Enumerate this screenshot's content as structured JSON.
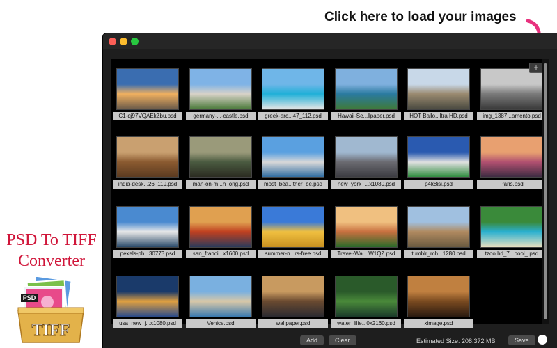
{
  "promo": {
    "title_line1": "PSD To TIFF",
    "title_line2": "Converter",
    "icon_psd_label": "PSD",
    "icon_tiff_label": "TIFF"
  },
  "hint": {
    "text": "Click here to load your images"
  },
  "toolbar": {
    "add_images_icon": "+"
  },
  "images": [
    {
      "name": "C1-qj97VQAEkZbu.psd",
      "colors": [
        "#3a6db0",
        "#f0b060",
        "#6a5a4a"
      ]
    },
    {
      "name": "germany-...-castle.psd",
      "colors": [
        "#7fb3e6",
        "#d8d2c8",
        "#4a7a3a"
      ]
    },
    {
      "name": "greek-arc...47_112.psd",
      "colors": [
        "#6fb6e8",
        "#1fb0d8",
        "#e6e6e6"
      ]
    },
    {
      "name": "Hawaii-Se...llpaper.psd",
      "colors": [
        "#7fb0de",
        "#2a7aa0",
        "#3f7a3a"
      ]
    },
    {
      "name": "HOT Ballo...ltra HD.psd",
      "colors": [
        "#c8d8e8",
        "#9a8a70",
        "#4a4a40"
      ]
    },
    {
      "name": "img_1387...amento.psd",
      "colors": [
        "#c8c8c8",
        "#7a7a7a",
        "#3a3a3a"
      ]
    },
    {
      "name": "india-desk...26_119.psd",
      "colors": [
        "#c9a070",
        "#8a5a30",
        "#5a3a20"
      ]
    },
    {
      "name": "man-on-m...h_orig.psd",
      "colors": [
        "#9a9a7a",
        "#4a5a40",
        "#2a2a20"
      ]
    },
    {
      "name": "most_bea...ther_be.psd",
      "colors": [
        "#5aa0e0",
        "#d8d8d8",
        "#2a6aa0"
      ]
    },
    {
      "name": "new_york_...x1080.psd",
      "colors": [
        "#a0b8d0",
        "#6a6a70",
        "#3a3a40"
      ]
    },
    {
      "name": "p4k8isi.psd",
      "colors": [
        "#2a5ab0",
        "#e0e0e0",
        "#2a8a3a"
      ]
    },
    {
      "name": "Paris.psd",
      "colors": [
        "#e8a070",
        "#b05070",
        "#3a2a40"
      ]
    },
    {
      "name": "pexels-ph...30773.psd",
      "colors": [
        "#4a8ad0",
        "#e8e8e8",
        "#2a4a6a"
      ]
    },
    {
      "name": "san_franci...x1600.psd",
      "colors": [
        "#e0a050",
        "#c04020",
        "#2a3a5a"
      ]
    },
    {
      "name": "summer-n...rs-free.psd",
      "colors": [
        "#3a7ad8",
        "#f0c040",
        "#c89020"
      ]
    },
    {
      "name": "Travel-Wal...W1QZ.psd",
      "colors": [
        "#f0c080",
        "#c87040",
        "#2a6a2a"
      ]
    },
    {
      "name": "tumblr_mh...1280.psd",
      "colors": [
        "#a0c0e0",
        "#b08a60",
        "#6a5a40"
      ]
    },
    {
      "name": "tzoo.hd_7...pool_.psd",
      "colors": [
        "#3a8a3a",
        "#2ab0d0",
        "#e8e0c0"
      ]
    },
    {
      "name": "usa_new_j...x1080.psd",
      "colors": [
        "#1a3a6a",
        "#e0a040",
        "#2a4a8a"
      ]
    },
    {
      "name": "Venice.psd",
      "colors": [
        "#7ab0e0",
        "#d8c8a8",
        "#3a7ab0"
      ]
    },
    {
      "name": "wallpaper.psd",
      "colors": [
        "#c89a60",
        "#6a4a30",
        "#2a2a30"
      ]
    },
    {
      "name": "water_lilie...0x2160.psd",
      "colors": [
        "#2a5a2a",
        "#4a8a3a",
        "#1a3a2a"
      ]
    },
    {
      "name": "ximage.psd",
      "colors": [
        "#c08040",
        "#7a4a20",
        "#2a1a10"
      ]
    }
  ],
  "bottom": {
    "add_label": "Add",
    "clear_label": "Clear",
    "estimated_size": "Estimated Size: 208.372 MB",
    "save_label": "Save"
  },
  "colors": {
    "accent_arrow": "#e8317e",
    "window_bg": "#1e1e1e",
    "grid_bg": "#000000",
    "caption_bg": "#c9c9c9",
    "promo_title": "#d0163a"
  }
}
